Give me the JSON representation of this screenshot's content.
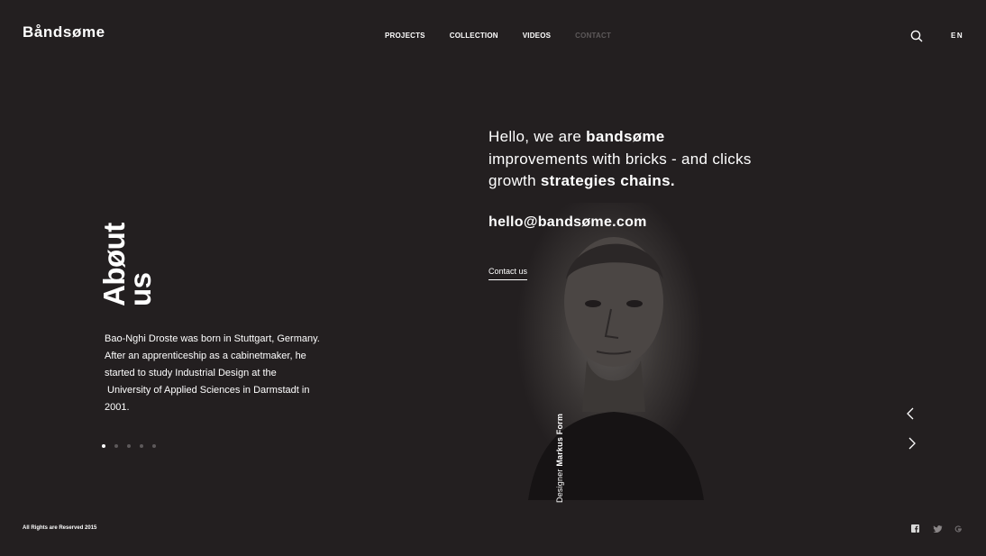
{
  "brand": {
    "logo": "Båndsøme"
  },
  "nav": {
    "items": [
      "PROJECTS",
      "COLLECTION",
      "VIDEOS",
      "CONTACT"
    ],
    "active_muted": "CONTACT"
  },
  "header": {
    "lang": "EN",
    "search_icon": "search-icon"
  },
  "about": {
    "title_line1": "Abøut",
    "title_line2": "us",
    "bio_lines": [
      "Bao-Nghi Droste was born in Stuttgart, Germany.",
      "After an apprenticeship as a cabinetmaker, he",
      "started to study Industrial Design at the",
      " University of Applied Sciences in Darmstadt in",
      "2001."
    ],
    "slider_total": 5,
    "slider_active": 1
  },
  "intro": {
    "greeting": "Hello, we are ",
    "brand": "bandsøme",
    "line2": "improvements with bricks - and clicks",
    "line3_prefix": "growth ",
    "line3_bold": "strategies chains.",
    "email": "hello@bandsøme.com",
    "contact_label": "Contact us"
  },
  "credit": {
    "role": "Designer ",
    "name": "Markus Form"
  },
  "footer": {
    "copyright": "All Rights are Reserved 2015",
    "social_icons": [
      "facebook-icon",
      "twitter-icon",
      "google-plus-icon"
    ]
  },
  "colors": {
    "background": "#231f20",
    "text": "#ffffff",
    "muted": "#5d595a"
  }
}
